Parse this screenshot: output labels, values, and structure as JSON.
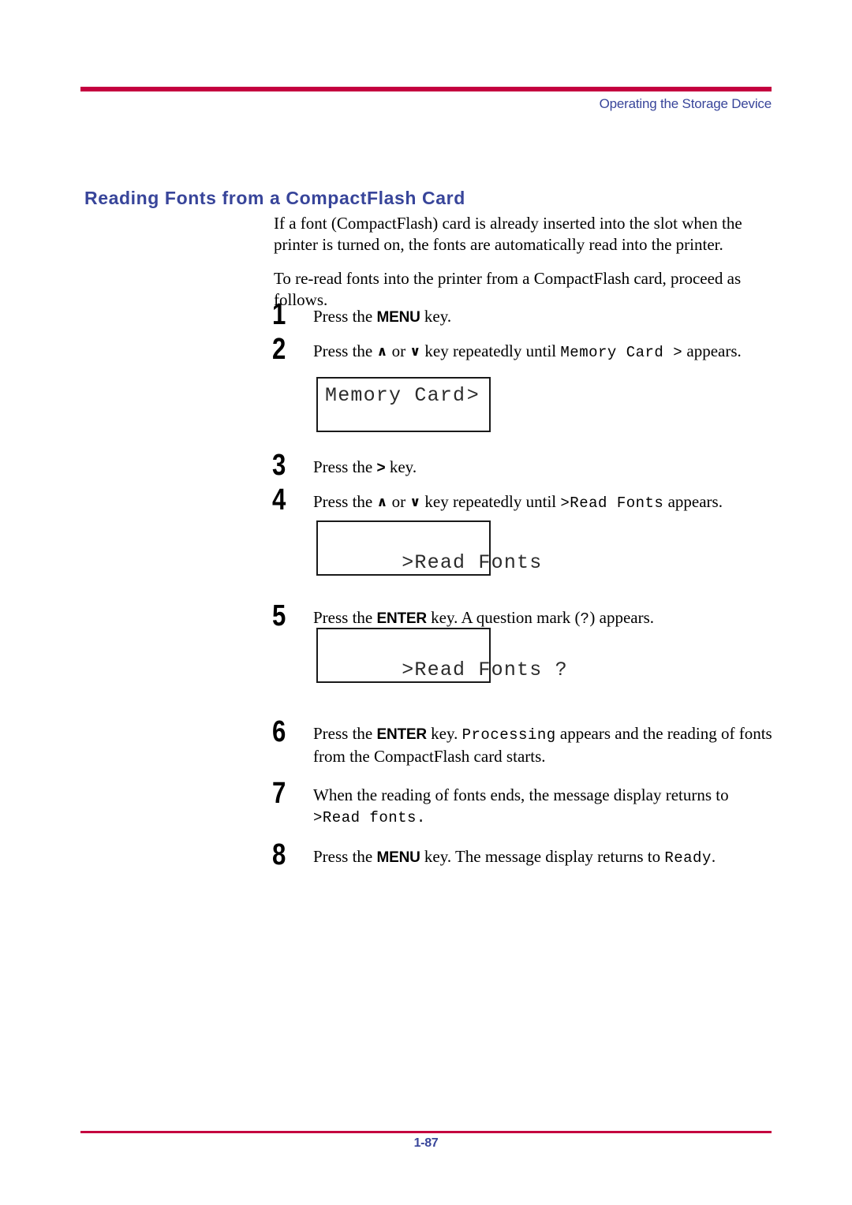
{
  "header": {
    "title": "Operating the Storage Device",
    "rule_color": "#C4003F",
    "title_color": "#38459A"
  },
  "heading": {
    "text": "Reading Fonts from a CompactFlash Card",
    "color": "#38459A"
  },
  "intro": {
    "paragraph1": "If a font (CompactFlash) card is already inserted into the slot when the printer is turned on, the fonts are automatically read into the printer.",
    "paragraph2": "To re-read fonts into the printer from a CompactFlash card, proceed as follows."
  },
  "steps": [
    {
      "number": "1",
      "parts": [
        {
          "type": "text",
          "value": "Press the "
        },
        {
          "type": "kbd",
          "value": "MENU"
        },
        {
          "type": "text",
          "value": " key."
        }
      ]
    },
    {
      "number": "2",
      "parts": [
        {
          "type": "text",
          "value": "Press the "
        },
        {
          "type": "chev",
          "value": "∧"
        },
        {
          "type": "text",
          "value": " or "
        },
        {
          "type": "chev",
          "value": "∨"
        },
        {
          "type": "text",
          "value": " key repeatedly until "
        },
        {
          "type": "mono",
          "value": "Memory Card >"
        },
        {
          "type": "text",
          "value": " appears."
        }
      ]
    },
    {
      "number": "3",
      "parts": [
        {
          "type": "text",
          "value": "Press the "
        },
        {
          "type": "gt",
          "value": ">"
        },
        {
          "type": "text",
          "value": " key."
        }
      ]
    },
    {
      "number": "4",
      "parts": [
        {
          "type": "text",
          "value": "Press the "
        },
        {
          "type": "chev",
          "value": "∧"
        },
        {
          "type": "text",
          "value": " or "
        },
        {
          "type": "chev",
          "value": "∨"
        },
        {
          "type": "text",
          "value": " key repeatedly until "
        },
        {
          "type": "mono",
          "value": ">Read Fonts"
        },
        {
          "type": "text",
          "value": " appears."
        }
      ]
    },
    {
      "number": "5",
      "parts": [
        {
          "type": "text",
          "value": "Press the "
        },
        {
          "type": "kbd",
          "value": "ENTER"
        },
        {
          "type": "text",
          "value": " key. A question mark ("
        },
        {
          "type": "mono",
          "value": "?"
        },
        {
          "type": "text",
          "value": ") appears."
        }
      ]
    },
    {
      "number": "6",
      "parts": [
        {
          "type": "text",
          "value": "Press the "
        },
        {
          "type": "kbd",
          "value": "ENTER"
        },
        {
          "type": "text",
          "value": " key. "
        },
        {
          "type": "mono",
          "value": "Processing"
        },
        {
          "type": "text",
          "value": " appears and the reading of fonts from the CompactFlash card starts."
        }
      ]
    },
    {
      "number": "7",
      "parts": [
        {
          "type": "text",
          "value": "When the reading of fonts ends, the message display returns to "
        },
        {
          "type": "mono",
          "value": ">Read fonts."
        }
      ]
    },
    {
      "number": "8",
      "parts": [
        {
          "type": "text",
          "value": "Press the "
        },
        {
          "type": "kbd",
          "value": "MENU"
        },
        {
          "type": "text",
          "value": " key. The message display returns to "
        },
        {
          "type": "mono",
          "value": "Ready"
        },
        {
          "type": "text",
          "value": "."
        }
      ]
    }
  ],
  "lcd_panels": [
    {
      "id": "lcd-memory-card",
      "left_text": "Memory Card",
      "right_text": ">"
    },
    {
      "id": "lcd-read-fonts",
      "left_text": ">Read Fonts",
      "right_text": ""
    },
    {
      "id": "lcd-read-fonts-q",
      "left_text": ">Read Fonts ?",
      "right_text": ""
    }
  ],
  "footer": {
    "page_number": "1-87",
    "rule_color": "#C4003F",
    "text_color": "#38459A"
  }
}
